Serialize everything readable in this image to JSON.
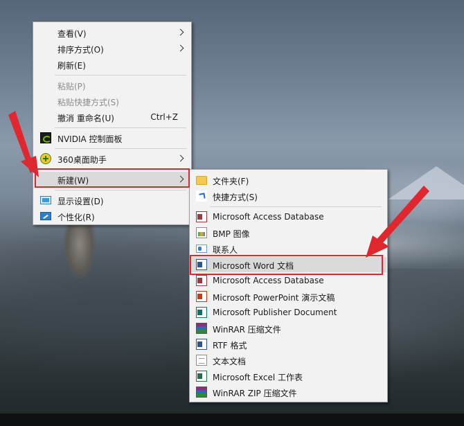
{
  "colors": {
    "annotation": "#e0262f",
    "menu_bg": "#f2f2f2",
    "highlight_bg": "#dadada"
  },
  "context_menu": {
    "items": [
      {
        "label": "查看(V)",
        "has_submenu": true
      },
      {
        "label": "排序方式(O)",
        "has_submenu": true
      },
      {
        "label": "刷新(E)"
      },
      {
        "label": "粘贴(P)",
        "disabled": true
      },
      {
        "label": "粘贴快捷方式(S)",
        "disabled": true
      },
      {
        "label": "撤消 重命名(U)",
        "shortcut": "Ctrl+Z"
      },
      {
        "label": "NVIDIA 控制面板",
        "icon": "nvidia-icon"
      },
      {
        "label": "360桌面助手",
        "icon": "360-icon",
        "has_submenu": true
      },
      {
        "label": "新建(W)",
        "has_submenu": true,
        "active": true
      },
      {
        "label": "显示设置(D)",
        "icon": "display-settings-icon"
      },
      {
        "label": "个性化(R)",
        "icon": "personalize-icon"
      }
    ]
  },
  "new_submenu": {
    "items": [
      {
        "label": "文件夹(F)",
        "icon": "folder-icon"
      },
      {
        "label": "快捷方式(S)",
        "icon": "shortcut-icon"
      },
      {
        "label": "Microsoft Access Database",
        "icon": "access-icon"
      },
      {
        "label": "BMP 图像",
        "icon": "bmp-icon"
      },
      {
        "label": "联系人",
        "icon": "contact-icon"
      },
      {
        "label": "Microsoft Word 文档",
        "icon": "word-icon",
        "active": true
      },
      {
        "label": "Microsoft Access Database",
        "icon": "access-icon"
      },
      {
        "label": "Microsoft PowerPoint 演示文稿",
        "icon": "powerpoint-icon"
      },
      {
        "label": "Microsoft Publisher Document",
        "icon": "publisher-icon"
      },
      {
        "label": "WinRAR 压缩文件",
        "icon": "winrar-icon"
      },
      {
        "label": "RTF 格式",
        "icon": "rtf-icon"
      },
      {
        "label": "文本文档",
        "icon": "text-document-icon"
      },
      {
        "label": "Microsoft Excel 工作表",
        "icon": "excel-icon"
      },
      {
        "label": "WinRAR ZIP 压缩文件",
        "icon": "winrar-zip-icon"
      }
    ]
  }
}
